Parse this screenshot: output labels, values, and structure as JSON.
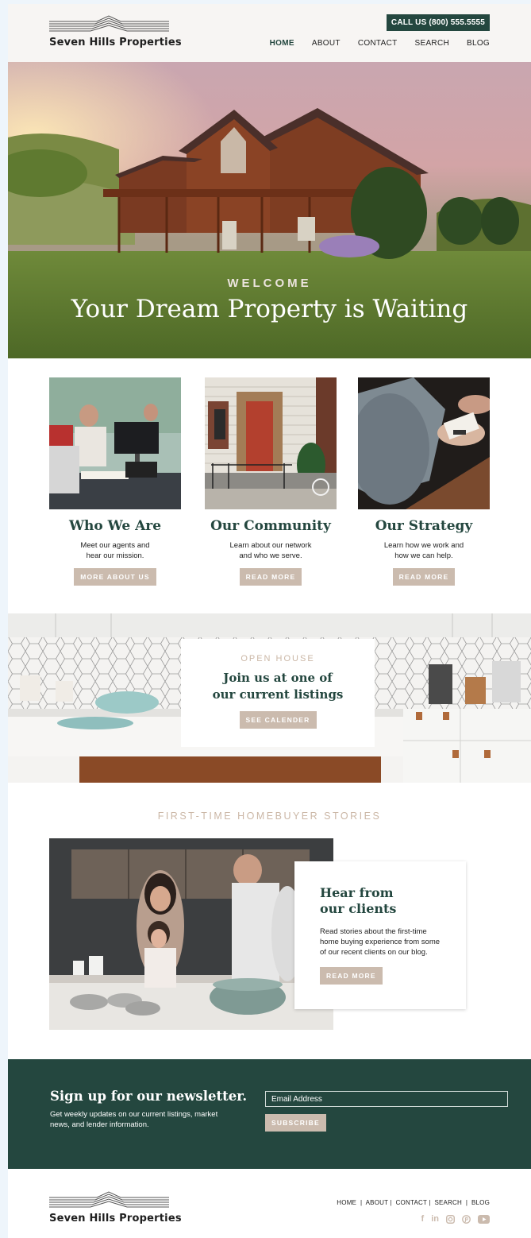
{
  "header": {
    "logo_text": "Seven Hills Properties",
    "call_button": "CALL US (800) 555.5555",
    "nav": [
      "HOME",
      "ABOUT",
      "CONTACT",
      "SEARCH",
      "BLOG"
    ],
    "active_nav": "HOME"
  },
  "hero": {
    "eyebrow": "WELCOME",
    "title": "Your Dream Property is Waiting"
  },
  "cards": [
    {
      "title": "Who We Are",
      "text_line1": "Meet our agents and",
      "text_line2": "hear our mission.",
      "button": "MORE ABOUT US"
    },
    {
      "title": "Our Community",
      "text_line1": "Learn about our network",
      "text_line2": "and who we serve.",
      "button": "READ MORE"
    },
    {
      "title": "Our Strategy",
      "text_line1": "Learn how we work and",
      "text_line2": "how we can help.",
      "button": "READ MORE"
    }
  ],
  "open_house": {
    "eyebrow": "OPEN HOUSE",
    "title_line1": "Join us at one of",
    "title_line2": "our current listings",
    "button": "SEE CALENDER"
  },
  "stories": {
    "section_title": "FIRST-TIME HOMEBUYER STORIES",
    "title_line1": "Hear from",
    "title_line2": "our clients",
    "text": "Read stories about the first-time home buying experience from some of our recent clients on our blog.",
    "button": "READ MORE"
  },
  "newsletter": {
    "title": "Sign up for our newsletter.",
    "text": "Get weekly updates on our current listings, market news, and lender information.",
    "email_placeholder": "Email Address",
    "button": "SUBSCRIBE"
  },
  "footer": {
    "logo_text": "Seven Hills Properties",
    "nav_text": "HOME  |  ABOUT |  CONTACT |  SEARCH  |  BLOG",
    "social_icons": [
      "facebook-icon",
      "linkedin-icon",
      "instagram-icon",
      "pinterest-icon",
      "youtube-icon"
    ]
  },
  "colors": {
    "brand_green": "#24473f",
    "accent_tan": "#cbbbae",
    "eyebrow_tan": "#cbb7a6"
  }
}
